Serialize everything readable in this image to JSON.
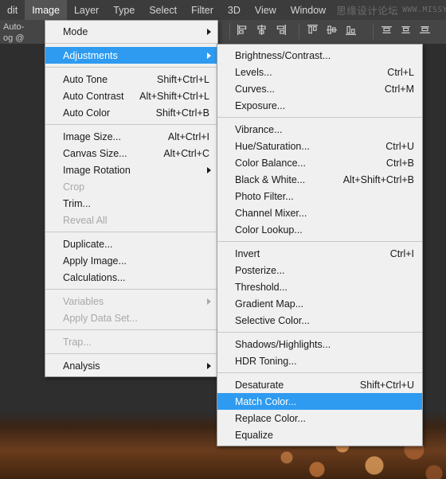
{
  "menubar": {
    "items": [
      {
        "label": "dit",
        "active": false
      },
      {
        "label": "Image",
        "active": true
      },
      {
        "label": "Layer",
        "active": false
      },
      {
        "label": "Type",
        "active": false
      },
      {
        "label": "Select",
        "active": false
      },
      {
        "label": "Filter",
        "active": false
      },
      {
        "label": "3D",
        "active": false
      },
      {
        "label": "View",
        "active": false
      },
      {
        "label": "Window",
        "active": false
      }
    ],
    "watermark_cn": "思缘设计论坛",
    "watermark_en": "WWW.MISSYUAN.COM"
  },
  "options_bar": {
    "line1": "Auto-",
    "line2": "og @",
    "align_icons_group1": [
      "align-left-edges-icon",
      "align-horizontal-centers-icon",
      "align-right-edges-icon"
    ],
    "align_icons_group2": [
      "align-top-edges-icon",
      "align-vertical-centers-icon",
      "align-bottom-edges-icon"
    ],
    "align_icons_group3": [
      "distribute-top-edges-icon",
      "distribute-vertical-centers-icon",
      "distribute-bottom-edges-icon"
    ]
  },
  "image_menu": {
    "title": "Image",
    "items": [
      {
        "label": "Mode",
        "accel": "",
        "submenu": true,
        "disabled": false,
        "selected": false
      },
      {
        "separator": true
      },
      {
        "label": "Adjustments",
        "accel": "",
        "submenu": true,
        "disabled": false,
        "selected": true
      },
      {
        "separator": true
      },
      {
        "label": "Auto Tone",
        "accel": "Shift+Ctrl+L",
        "submenu": false,
        "disabled": false,
        "selected": false
      },
      {
        "label": "Auto Contrast",
        "accel": "Alt+Shift+Ctrl+L",
        "submenu": false,
        "disabled": false,
        "selected": false
      },
      {
        "label": "Auto Color",
        "accel": "Shift+Ctrl+B",
        "submenu": false,
        "disabled": false,
        "selected": false
      },
      {
        "separator": true
      },
      {
        "label": "Image Size...",
        "accel": "Alt+Ctrl+I",
        "submenu": false,
        "disabled": false,
        "selected": false
      },
      {
        "label": "Canvas Size...",
        "accel": "Alt+Ctrl+C",
        "submenu": false,
        "disabled": false,
        "selected": false
      },
      {
        "label": "Image Rotation",
        "accel": "",
        "submenu": true,
        "disabled": false,
        "selected": false
      },
      {
        "label": "Crop",
        "accel": "",
        "submenu": false,
        "disabled": true,
        "selected": false
      },
      {
        "label": "Trim...",
        "accel": "",
        "submenu": false,
        "disabled": false,
        "selected": false
      },
      {
        "label": "Reveal All",
        "accel": "",
        "submenu": false,
        "disabled": true,
        "selected": false
      },
      {
        "separator": true
      },
      {
        "label": "Duplicate...",
        "accel": "",
        "submenu": false,
        "disabled": false,
        "selected": false
      },
      {
        "label": "Apply Image...",
        "accel": "",
        "submenu": false,
        "disabled": false,
        "selected": false
      },
      {
        "label": "Calculations...",
        "accel": "",
        "submenu": false,
        "disabled": false,
        "selected": false
      },
      {
        "separator": true
      },
      {
        "label": "Variables",
        "accel": "",
        "submenu": true,
        "disabled": true,
        "selected": false
      },
      {
        "label": "Apply Data Set...",
        "accel": "",
        "submenu": false,
        "disabled": true,
        "selected": false
      },
      {
        "separator": true
      },
      {
        "label": "Trap...",
        "accel": "",
        "submenu": false,
        "disabled": true,
        "selected": false
      },
      {
        "separator": true
      },
      {
        "label": "Analysis",
        "accel": "",
        "submenu": true,
        "disabled": false,
        "selected": false
      }
    ]
  },
  "adjustments_submenu": {
    "title": "Adjustments",
    "items": [
      {
        "label": "Brightness/Contrast...",
        "accel": "",
        "submenu": false,
        "disabled": false,
        "selected": false
      },
      {
        "label": "Levels...",
        "accel": "Ctrl+L",
        "submenu": false,
        "disabled": false,
        "selected": false
      },
      {
        "label": "Curves...",
        "accel": "Ctrl+M",
        "submenu": false,
        "disabled": false,
        "selected": false
      },
      {
        "label": "Exposure...",
        "accel": "",
        "submenu": false,
        "disabled": false,
        "selected": false
      },
      {
        "separator": true
      },
      {
        "label": "Vibrance...",
        "accel": "",
        "submenu": false,
        "disabled": false,
        "selected": false
      },
      {
        "label": "Hue/Saturation...",
        "accel": "Ctrl+U",
        "submenu": false,
        "disabled": false,
        "selected": false
      },
      {
        "label": "Color Balance...",
        "accel": "Ctrl+B",
        "submenu": false,
        "disabled": false,
        "selected": false
      },
      {
        "label": "Black & White...",
        "accel": "Alt+Shift+Ctrl+B",
        "submenu": false,
        "disabled": false,
        "selected": false
      },
      {
        "label": "Photo Filter...",
        "accel": "",
        "submenu": false,
        "disabled": false,
        "selected": false
      },
      {
        "label": "Channel Mixer...",
        "accel": "",
        "submenu": false,
        "disabled": false,
        "selected": false
      },
      {
        "label": "Color Lookup...",
        "accel": "",
        "submenu": false,
        "disabled": false,
        "selected": false
      },
      {
        "separator": true
      },
      {
        "label": "Invert",
        "accel": "Ctrl+I",
        "submenu": false,
        "disabled": false,
        "selected": false
      },
      {
        "label": "Posterize...",
        "accel": "",
        "submenu": false,
        "disabled": false,
        "selected": false
      },
      {
        "label": "Threshold...",
        "accel": "",
        "submenu": false,
        "disabled": false,
        "selected": false
      },
      {
        "label": "Gradient Map...",
        "accel": "",
        "submenu": false,
        "disabled": false,
        "selected": false
      },
      {
        "label": "Selective Color...",
        "accel": "",
        "submenu": false,
        "disabled": false,
        "selected": false
      },
      {
        "separator": true
      },
      {
        "label": "Shadows/Highlights...",
        "accel": "",
        "submenu": false,
        "disabled": false,
        "selected": false
      },
      {
        "label": "HDR Toning...",
        "accel": "",
        "submenu": false,
        "disabled": false,
        "selected": false
      },
      {
        "separator": true
      },
      {
        "label": "Desaturate",
        "accel": "Shift+Ctrl+U",
        "submenu": false,
        "disabled": false,
        "selected": false
      },
      {
        "label": "Match Color...",
        "accel": "",
        "submenu": false,
        "disabled": false,
        "selected": true
      },
      {
        "label": "Replace Color...",
        "accel": "",
        "submenu": false,
        "disabled": false,
        "selected": false
      },
      {
        "label": "Equalize",
        "accel": "",
        "submenu": false,
        "disabled": false,
        "selected": false
      }
    ]
  },
  "colors": {
    "menu_background": "#f0f0f0",
    "menu_highlight": "#2e9bf0",
    "menubar_background": "#3c3c3c",
    "menubar_active": "#545454",
    "workspace": "#2e2e2e",
    "disabled_text": "#a8a8a8"
  }
}
